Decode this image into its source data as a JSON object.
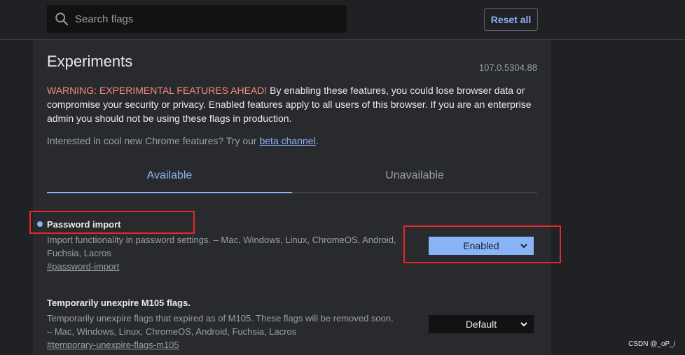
{
  "search": {
    "placeholder": "Search flags"
  },
  "toolbar": {
    "reset_label": "Reset all"
  },
  "page": {
    "title": "Experiments",
    "version": "107.0.5304.88",
    "warning_prefix": "WARNING: EXPERIMENTAL FEATURES AHEAD!",
    "warning_body": " By enabling these features, you could lose browser data or compromise your security or privacy. Enabled features apply to all users of this browser. If you are an enterprise admin you should not be using these flags in production.",
    "interest_text": "Interested in cool new Chrome features? Try our ",
    "interest_link": "beta channel",
    "interest_suffix": "."
  },
  "tabs": [
    {
      "label": "Available",
      "active": true
    },
    {
      "label": "Unavailable",
      "active": false
    }
  ],
  "flags": [
    {
      "title": "Password import",
      "description": "Import functionality in password settings. – Mac, Windows, Linux, ChromeOS, Android, Fuchsia, Lacros",
      "link": "#password-import",
      "value": "Enabled"
    },
    {
      "title": "Temporarily unexpire M105 flags.",
      "description": "Temporarily unexpire flags that expired as of M105. These flags will be removed soon. – Mac, Windows, Linux, ChromeOS, Android, Fuchsia, Lacros",
      "link": "#temporary-unexpire-flags-m105",
      "value": "Default"
    }
  ],
  "watermark": "CSDN @_oP_i",
  "colors": {
    "accent": "#8ab4f8",
    "warning": "#f28b82",
    "highlight": "#e52828"
  }
}
